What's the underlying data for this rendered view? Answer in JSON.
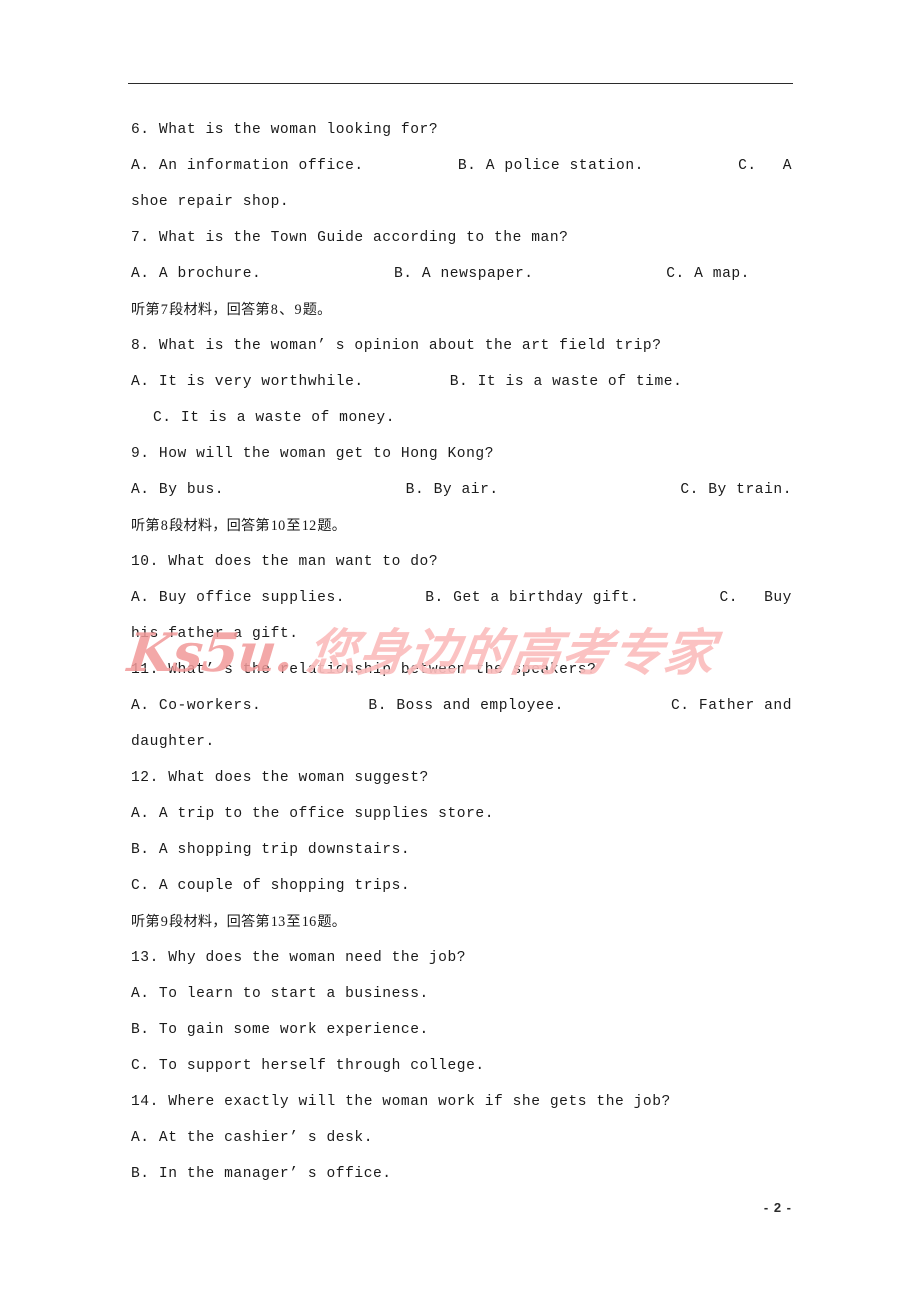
{
  "document": {
    "page_number": "- 2 -",
    "header_rule": true
  },
  "watermark": {
    "latin": "Ks5u.",
    "cjk": "您身边的高考专家",
    "color_latin": "#f29a9a",
    "color_cjk": "#fbbdbd"
  },
  "content": {
    "q6": {
      "stem": "6. What is the woman looking for?",
      "a": "A. An information office.",
      "b": "B. A police station.",
      "c_head": "C.",
      "c_tail": "A",
      "c_wrap": "shoe repair shop."
    },
    "q7": {
      "stem": "7. What is the Town Guide according to the man?",
      "a": "A. A brochure.",
      "b": "B. A newspaper.",
      "c": "C. A map."
    },
    "dir_7": {
      "p1": "听第",
      "n1": "7",
      "p2": "段材料，回答第",
      "n2": "8",
      "p3": "、",
      "n3": "9",
      "p4": "题。"
    },
    "q8": {
      "stem": "8. What is the woman’ s opinion about the art field trip?",
      "a": "A. It is very worthwhile.",
      "b": "B. It is a waste of time.",
      "c": "C. It is a waste of money."
    },
    "q9": {
      "stem": "9. How will the woman get to Hong Kong?",
      "a": "A. By bus.",
      "b": "B. By air.",
      "c": "C. By train."
    },
    "dir_8": {
      "p1": "听第",
      "n1": "8",
      "p2": "段材料，回答第",
      "n2": "10",
      "p3": "至",
      "n3": "12",
      "p4": "题。"
    },
    "q10": {
      "stem": "10. What does the man want to do?",
      "a": "A. Buy office supplies.",
      "b": "B. Get a birthday gift.",
      "c_head": "C.",
      "c_tail": "Buy",
      "c_wrap": "his father a gift."
    },
    "q11": {
      "stem": "11. What’ s the relationship between the speakers?",
      "a": "A. Co-workers.",
      "b": "B. Boss and employee.",
      "c": "C. Father and",
      "c_wrap": "daughter."
    },
    "q12": {
      "stem": "12. What does the woman suggest?",
      "a": "A. A trip to the office supplies store.",
      "b": "B. A shopping trip downstairs.",
      "c": "C. A couple of shopping trips."
    },
    "dir_9": {
      "p1": "听第",
      "n1": "9",
      "p2": "段材料，回答第",
      "n2": "13",
      "p3": "至",
      "n3": "16",
      "p4": "题。"
    },
    "q13": {
      "stem": "13. Why does the woman need the job?",
      "a": "A. To learn to start a business.",
      "b": "B. To gain some work experience.",
      "c": "C. To support herself through college."
    },
    "q14": {
      "stem": "14. Where exactly will the woman work if she gets the job?",
      "a": "A. At the cashier’ s desk.",
      "b": "B. In the manager’ s office."
    }
  }
}
